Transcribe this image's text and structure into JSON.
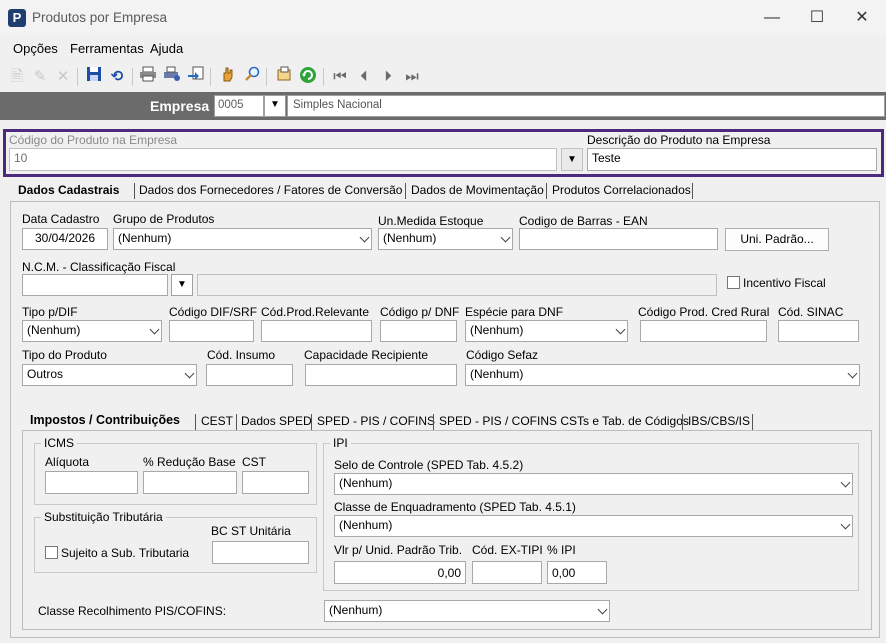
{
  "window": {
    "title": "Produtos por Empresa",
    "app_icon_letter": "P",
    "minimize": "—",
    "maximize": "☐",
    "close": "✕"
  },
  "menu": [
    "Opções",
    "Ferramentas",
    "Ajuda"
  ],
  "empresa": {
    "label": "Empresa",
    "code": "0005",
    "name": "Simples Nacional"
  },
  "produto": {
    "codigo_label": "Código do Produto na Empresa",
    "codigo_value": "10",
    "descricao_label": "Descrição do Produto na Empresa",
    "descricao_value": "Teste"
  },
  "tabs": [
    "Dados Cadastrais",
    "Dados dos Fornecedores / Fatores de Conversão",
    "Dados de Movimentação",
    "Produtos Correlacionados"
  ],
  "form": {
    "data_cadastro_label": "Data Cadastro",
    "data_cadastro_value": "30/04/2026",
    "grupo_label": "Grupo de Produtos",
    "grupo_value": "(Nenhum)",
    "un_medida_label": "Un.Medida Estoque",
    "un_medida_value": "(Nenhum)",
    "ean_label": "Codigo de Barras - EAN",
    "ean_value": "",
    "uni_padrao_button": "Uni. Padrão...",
    "ncm_label": "N.C.M. -  Classificação Fiscal",
    "ncm_value": "",
    "ncm_desc": "",
    "incentivo_label": "Incentivo Fiscal",
    "tipo_dif_label": "Tipo p/DIF",
    "tipo_dif_value": "(Nenhum)",
    "cod_dif_srf_label": "Código DIF/SRF",
    "cod_prod_relevante_label": "Cód.Prod.Relevante",
    "cod_dnf_label": "Código p/ DNF",
    "especie_dnf_label": "Espécie para DNF",
    "especie_dnf_value": "(Nenhum)",
    "cod_cred_rural_label": "Código Prod. Cred Rural",
    "cod_sinac_label": "Cód. SINAC",
    "tipo_produto_label": "Tipo do Produto",
    "tipo_produto_value": "Outros",
    "cod_insumo_label": "Cód. Insumo",
    "capacidade_label": "Capacidade Recipiente",
    "cod_sefaz_label": "Código Sefaz",
    "cod_sefaz_value": "(Nenhum)"
  },
  "sub_tabs": [
    "Impostos / Contribuições",
    "CEST",
    "Dados SPED",
    "SPED - PIS / COFINS",
    "SPED - PIS / COFINS CSTs e Tab. de Códigos",
    "IBS/CBS/IS"
  ],
  "icms": {
    "title": "ICMS",
    "aliquota_label": "Alíquota",
    "reducao_label": "% Redução Base",
    "cst_label": "CST"
  },
  "st": {
    "title": "Substituição Tributária",
    "bc_label": "BC ST Unitária",
    "sujeito_label": "Sujeito a Sub. Tributaria"
  },
  "ipi": {
    "title": "IPI",
    "selo_label": "Selo de Controle (SPED Tab. 4.5.2)",
    "selo_value": "(Nenhum)",
    "classe_label": "Classe de Enquadramento (SPED Tab. 4.5.1)",
    "classe_value": "(Nenhum)",
    "vlr_label": "Vlr p/ Unid. Padrão Trib.",
    "vlr_value": "0,00",
    "ex_tipi_label": "Cód. EX-TIPI",
    "perc_label": "% IPI",
    "perc_value": "0,00"
  },
  "classe_pis": {
    "label": "Classe Recolhimento PIS/COFINS:",
    "value": "(Nenhum)"
  }
}
